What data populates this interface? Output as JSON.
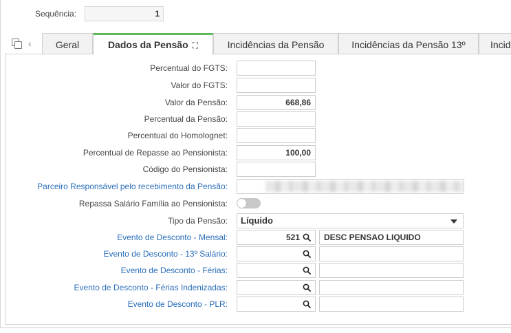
{
  "header": {
    "sequencia_label": "Sequência:",
    "sequencia_value": "1"
  },
  "tabs": [
    {
      "label": "Geral",
      "active": false
    },
    {
      "label": "Dados da Pensão",
      "active": true
    },
    {
      "label": "Incidências da Pensão",
      "active": false
    },
    {
      "label": "Incidências da Pensão 13º",
      "active": false
    },
    {
      "label": "Incid",
      "active": false
    }
  ],
  "form": {
    "percentual_fgts": {
      "label": "Percentual do FGTS:",
      "value": ""
    },
    "valor_fgts": {
      "label": "Valor do FGTS:",
      "value": ""
    },
    "valor_pensao": {
      "label": "Valor da Pensão:",
      "value": "668,86"
    },
    "percentual_pensao": {
      "label": "Percentual da Pensão:",
      "value": ""
    },
    "percentual_homolognet": {
      "label": "Percentual do Homolognet:",
      "value": ""
    },
    "percentual_repasse": {
      "label": "Percentual de Repasse ao Pensionista:",
      "value": "100,00"
    },
    "codigo_pensionista": {
      "label": "Código do Pensionista:",
      "value": ""
    },
    "parceiro_responsavel": {
      "label": "Parceiro Responsável pelo recebimento da Pensão:"
    },
    "repassa_salario_familia": {
      "label": "Repassa Salário Família ao Pensionista:",
      "checked": false
    },
    "tipo_pensao": {
      "label": "Tipo da Pensão:",
      "value": "Líquido"
    },
    "evento_mensal": {
      "label": "Evento de Desconto - Mensal:",
      "code": "521",
      "description": "DESC PENSAO LIQUIDO"
    },
    "evento_13": {
      "label": "Evento de Desconto - 13º Salário:",
      "code": "",
      "description": ""
    },
    "evento_ferias": {
      "label": "Evento de Desconto - Férias:",
      "code": "",
      "description": ""
    },
    "evento_ferias_indenizadas": {
      "label": "Evento de Desconto - Férias Indenizadas:",
      "code": "",
      "description": ""
    },
    "evento_plr": {
      "label": "Evento de Desconto - PLR:",
      "code": "",
      "description": ""
    }
  },
  "colors": {
    "accent_tab": "#5cb85c",
    "link_label": "#2a6ebb"
  }
}
